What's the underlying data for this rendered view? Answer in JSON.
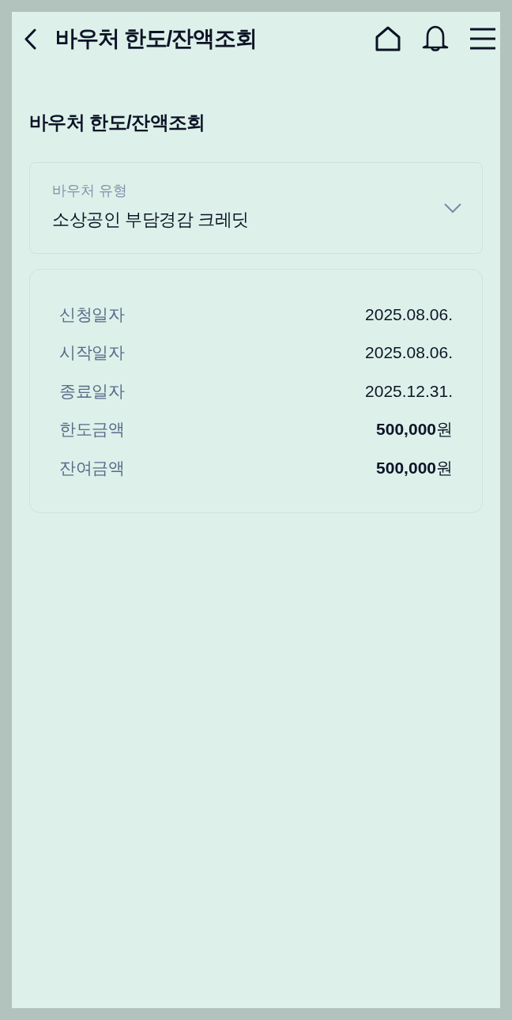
{
  "header": {
    "title": "바우처 한도/잔액조회"
  },
  "section_title": "바우처 한도/잔액조회",
  "voucher_type": {
    "label": "바우처 유형",
    "value": "소상공인 부담경감 크레딧"
  },
  "details": [
    {
      "label": "신청일자",
      "value": "2025.08.06."
    },
    {
      "label": "시작일자",
      "value": "2025.08.06."
    },
    {
      "label": "종료일자",
      "value": "2025.12.31."
    },
    {
      "label": "한도금액",
      "value": "**500,000**원"
    },
    {
      "label": "잔여금액",
      "value": "**500,000**원"
    }
  ]
}
